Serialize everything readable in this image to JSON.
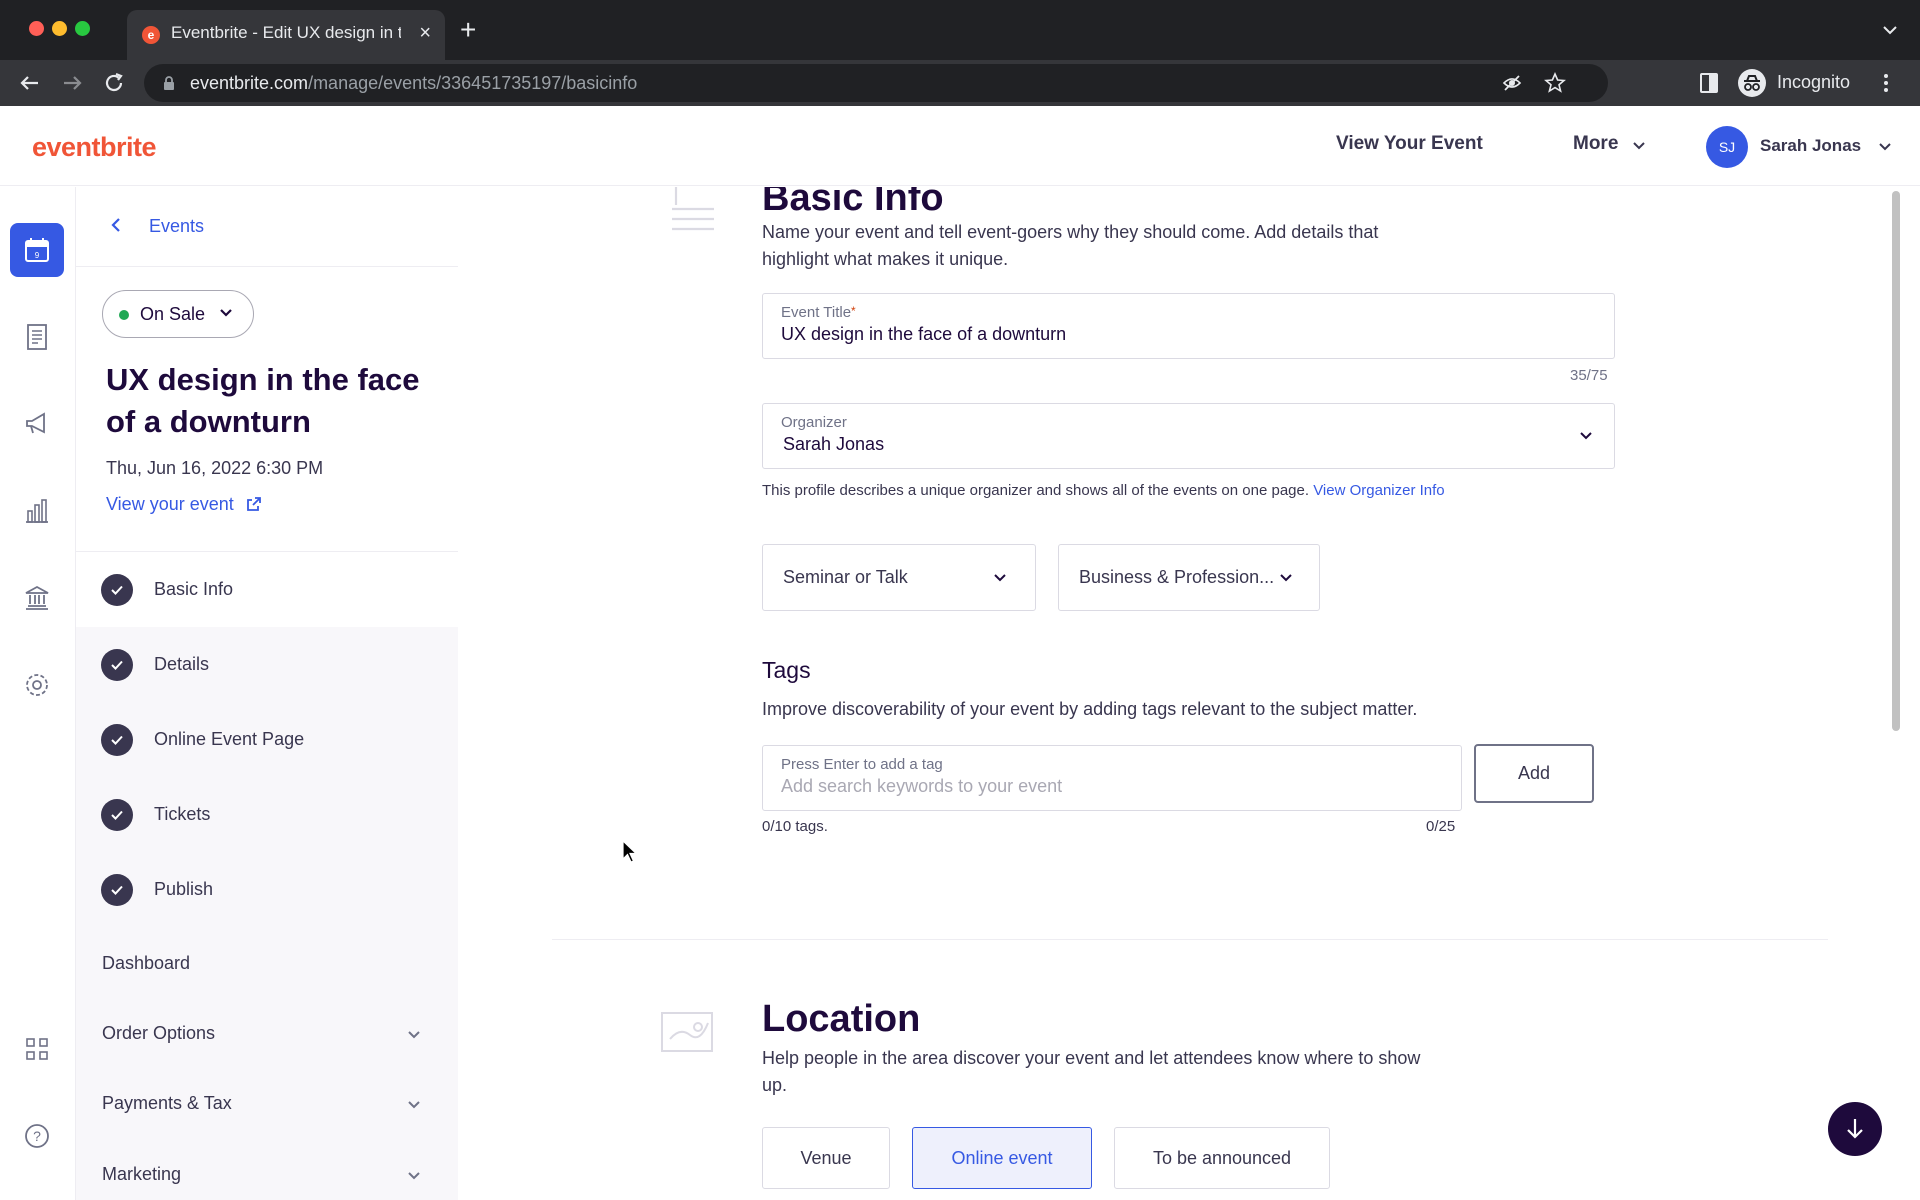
{
  "browser": {
    "tab_title": "Eventbrite - Edit UX design in the face of a downturn",
    "url_host": "eventbrite.com",
    "url_path": "/manage/events/336451735197/basicinfo",
    "profile_label": "Incognito"
  },
  "header": {
    "logo": "eventbrite",
    "view_event": "View Your Event",
    "more": "More",
    "user_initials": "SJ",
    "user_name": "Sarah Jonas"
  },
  "sidebar": {
    "back_label": "Events",
    "status": "On Sale",
    "event_title": "UX design in the face of a downturn",
    "event_date": "Thu, Jun 16, 2022 6:30 PM",
    "view_event_link": "View your event",
    "steps": [
      {
        "label": "Basic Info",
        "active": true
      },
      {
        "label": "Details",
        "active": false
      },
      {
        "label": "Online Event Page",
        "active": false
      },
      {
        "label": "Tickets",
        "active": false
      },
      {
        "label": "Publish",
        "active": false
      }
    ],
    "dashboard": "Dashboard",
    "order_options": "Order Options",
    "payments_tax": "Payments & Tax",
    "marketing": "Marketing"
  },
  "basic_info": {
    "title": "Basic Info",
    "description": "Name your event and tell event-goers why they should come. Add details that highlight what makes it unique.",
    "event_title_label": "Event Title",
    "event_title_value": "UX design in the face of a downturn",
    "title_counter": "35/75",
    "organizer_label": "Organizer",
    "organizer_value": "Sarah Jonas",
    "organizer_helper": "This profile describes a unique organizer and shows all of the events on one page.",
    "organizer_link": "View Organizer Info",
    "type_select": "Seminar or Talk",
    "category_select": "Business & Profession...",
    "tags_title": "Tags",
    "tags_description": "Improve discoverability of your event by adding tags relevant to the subject matter.",
    "tag_label": "Press Enter to add a tag",
    "tag_placeholder": "Add search keywords to your event",
    "add_button": "Add",
    "tags_count": "0/10 tags.",
    "tag_char_count": "0/25"
  },
  "location": {
    "title": "Location",
    "description": "Help people in the area discover your event and let attendees know where to show up.",
    "options": [
      "Venue",
      "Online event",
      "To be announced"
    ],
    "selected": "Online event"
  },
  "colors": {
    "brand": "#f05537",
    "accent": "#3659e3",
    "ink": "#1e0a3c"
  }
}
